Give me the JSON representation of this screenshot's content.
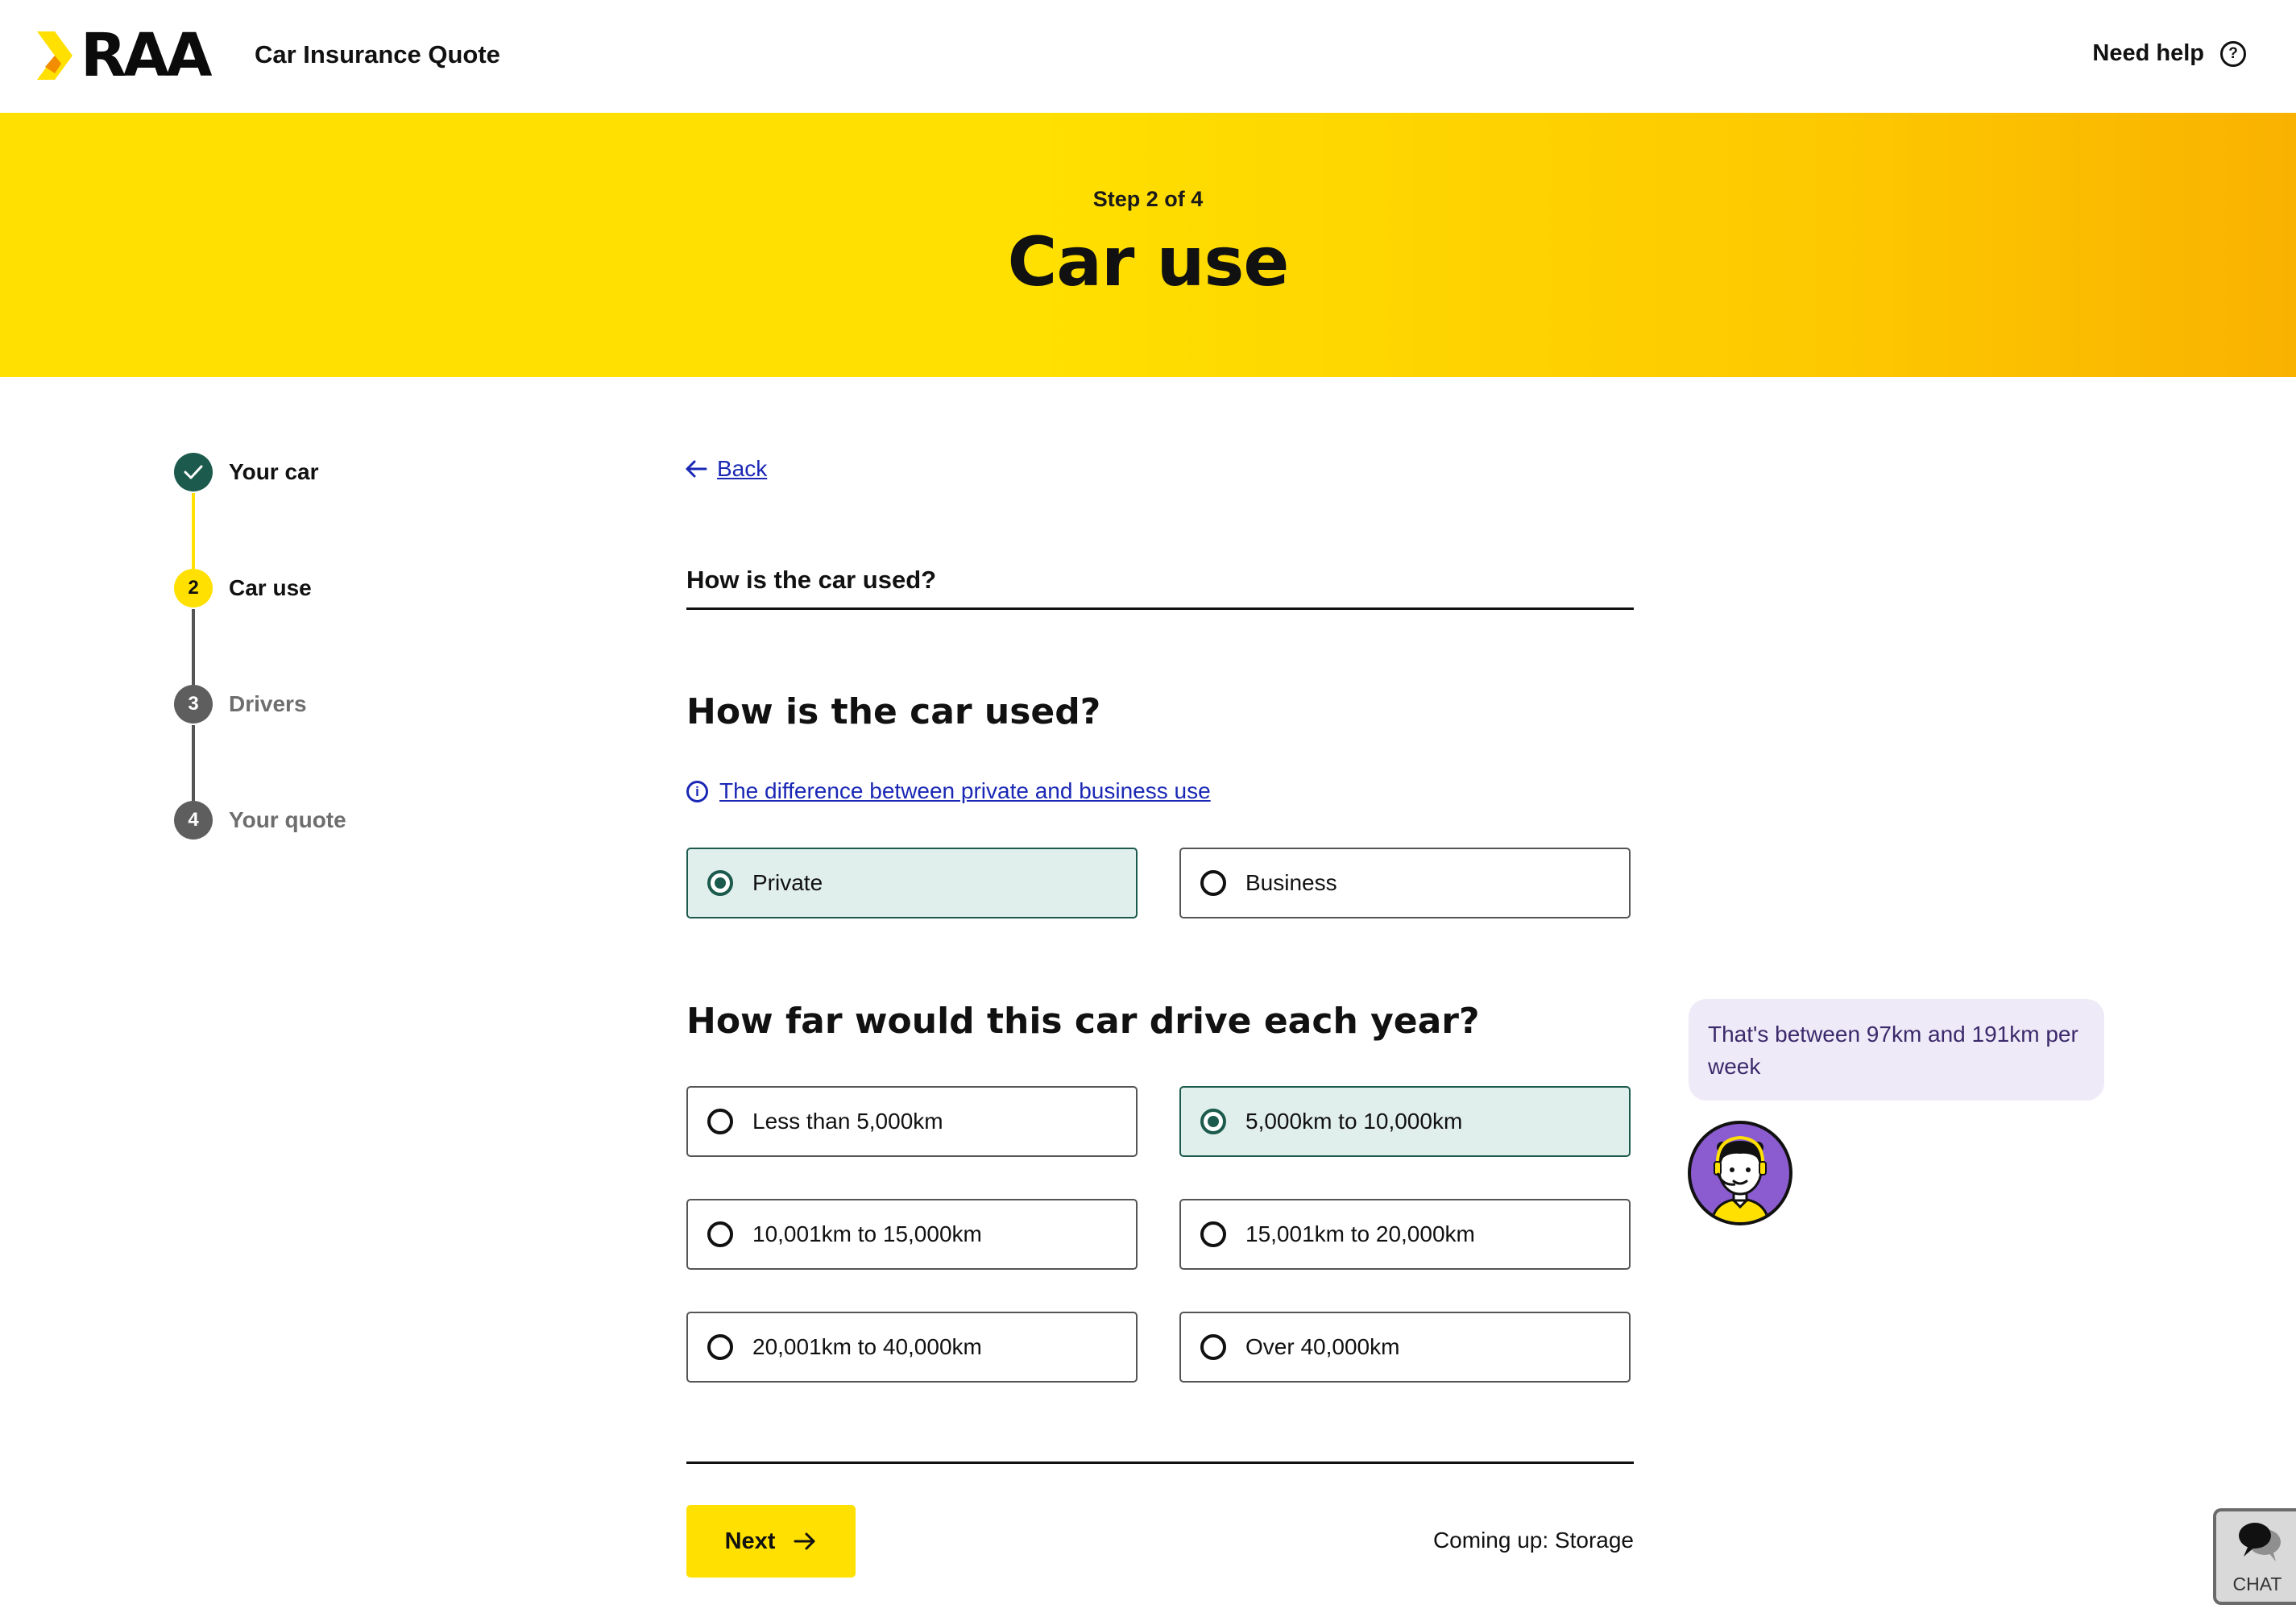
{
  "header": {
    "logo_text": "RAA",
    "app_title": "Car Insurance Quote",
    "help_label": "Need help"
  },
  "hero": {
    "step_text": "Step 2 of 4",
    "title": "Car use"
  },
  "stepper": {
    "steps": [
      {
        "number": "1",
        "label": "Your car",
        "status": "complete"
      },
      {
        "number": "2",
        "label": "Car use",
        "status": "active"
      },
      {
        "number": "3",
        "label": "Drivers",
        "status": "upcoming"
      },
      {
        "number": "4",
        "label": "Your quote",
        "status": "upcoming"
      }
    ]
  },
  "main": {
    "back_label": "Back",
    "section_label": "How is the car used?",
    "usage": {
      "question": "How is the car used?",
      "info_link": "The difference between private and business use",
      "options": [
        {
          "label": "Private",
          "selected": true
        },
        {
          "label": "Business",
          "selected": false
        }
      ]
    },
    "distance": {
      "question": "How far would this car drive each year?",
      "options": [
        {
          "label": "Less than 5,000km",
          "selected": false
        },
        {
          "label": "5,000km to 10,000km",
          "selected": true
        },
        {
          "label": "10,001km to 15,000km",
          "selected": false
        },
        {
          "label": "15,001km to 20,000km",
          "selected": false
        },
        {
          "label": "20,001km to 40,000km",
          "selected": false
        },
        {
          "label": "Over 40,000km",
          "selected": false
        }
      ]
    },
    "next_label": "Next",
    "coming_up": "Coming up: Storage"
  },
  "assistant": {
    "message": "That's between 97km and 191km per week"
  },
  "chat_widget": {
    "label": "CHAT"
  },
  "colors": {
    "brand_yellow": "#ffe000",
    "brand_green": "#1b5a4c",
    "selected_bg": "#e1efec",
    "link_blue": "#1a28b5",
    "bubble_bg": "#efeaf8",
    "avatar_purple": "#8a5ccf"
  },
  "icons": {
    "help": "question-circle-icon",
    "back": "arrow-left-icon",
    "info": "info-circle-icon",
    "next": "arrow-right-icon",
    "complete": "check-icon",
    "chat": "speech-bubbles-icon"
  }
}
